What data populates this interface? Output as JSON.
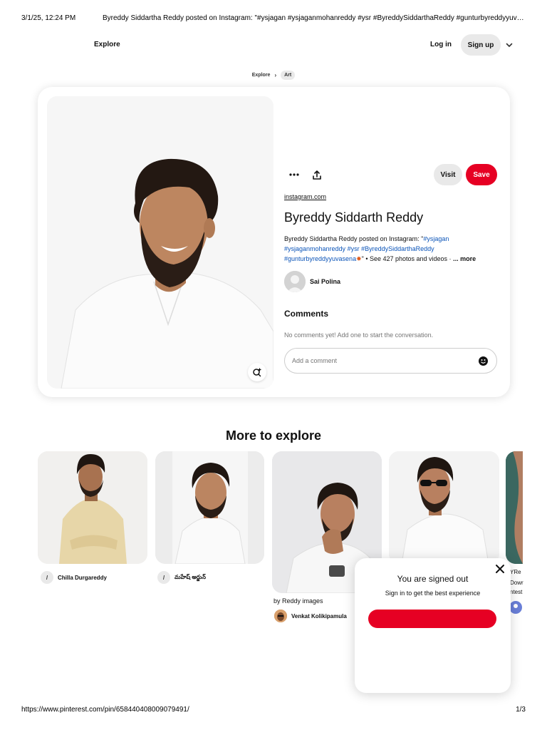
{
  "print": {
    "date": "3/1/25, 12:24 PM",
    "title": "Byreddy Siddartha Reddy posted on Instagram: \"#ysjagan #ysjaganmohanreddy #ysr #ByreddySiddarthaReddy #gunturbyreddyyuv…",
    "url": "https://www.pinterest.com/pin/658440408009079491/",
    "page": "1/3"
  },
  "nav": {
    "explore": "Explore",
    "login": "Log in",
    "signup": "Sign up"
  },
  "breadcrumb": {
    "items": [
      "Explore",
      "Art"
    ]
  },
  "pin": {
    "visit": "Visit",
    "save": "Save",
    "source": "instagram.com",
    "title": "Byreddy Siddarth Reddy",
    "desc_plain_1": "Byreddy Siddartha Reddy posted on Instagram: \"",
    "desc_tag_1": "#ysjagan",
    "desc_tag_2": "#ysjaganmohanreddy",
    "desc_tag_3": "#ysr",
    "desc_tag_4": "#ByreddySiddarthaReddy",
    "desc_tag_5": "#gunturbyreddyyuvasena",
    "desc_plain_2": "\" • See 427 photos and videos ·",
    "desc_more": "... more",
    "author": "Sai Polina",
    "comments_heading": "Comments",
    "no_comments": "No comments yet! Add one to start the conversation.",
    "comment_placeholder": "Add a comment"
  },
  "explore": {
    "heading": "More to explore",
    "cards": [
      {
        "pinner": "Chilla Durgareddy"
      },
      {
        "pinner": "మహేష్ అర్జున్"
      },
      {
        "board": "by Reddy images",
        "pinner": "Venkat Kolikipamula"
      }
    ],
    "edge_fragments": [
      "YRe",
      "Dowr",
      "ntest"
    ]
  },
  "modal": {
    "title": "You are signed out",
    "subtitle": "Sign in to get the best experience"
  },
  "colors": {
    "brand_red": "#e60023",
    "hashtag_blue": "#0b54b8",
    "button_gray": "#e9e9e9"
  }
}
